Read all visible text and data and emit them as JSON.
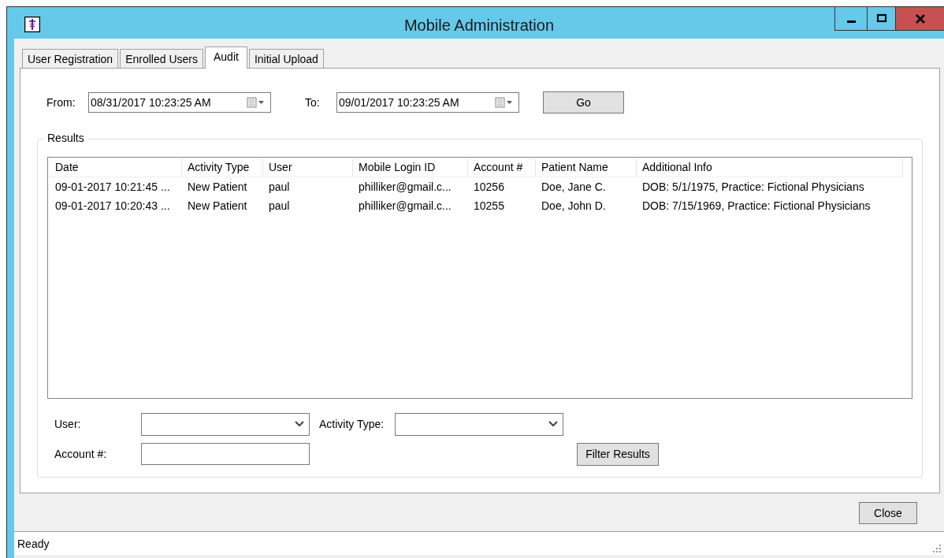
{
  "window": {
    "title": "Mobile Administration"
  },
  "tabs": [
    {
      "label": "User Registration",
      "selected": false
    },
    {
      "label": "Enrolled Users",
      "selected": false
    },
    {
      "label": "Audit",
      "selected": true
    },
    {
      "label": "Initial Upload",
      "selected": false
    }
  ],
  "date_range": {
    "from_label": "From:",
    "from_value": "08/31/2017 10:23:25 AM",
    "to_label": "To:",
    "to_value": "09/01/2017 10:23:25 AM",
    "go_button": "Go"
  },
  "results": {
    "title": "Results",
    "columns": [
      "Date",
      "Activity Type",
      "User",
      "Mobile Login ID",
      "Account #",
      "Patient Name",
      "Additional Info"
    ],
    "rows": [
      [
        "09-01-2017 10:21:45 ...",
        "New Patient",
        "paul",
        "philliker@gmail.c...",
        "10256",
        "Doe, Jane  C.",
        "DOB: 5/1/1975, Practice: Fictional Physicians"
      ],
      [
        "09-01-2017 10:20:43 ...",
        "New Patient",
        "paul",
        "philliker@gmail.c...",
        "10255",
        "Doe, John  D.",
        "DOB: 7/15/1969, Practice: Fictional Physicians"
      ]
    ]
  },
  "filters": {
    "user_label": "User:",
    "activity_label": "Activity Type:",
    "account_label": "Account #:",
    "filter_button": "Filter Results"
  },
  "close_button": "Close",
  "status_bar": "Ready"
}
